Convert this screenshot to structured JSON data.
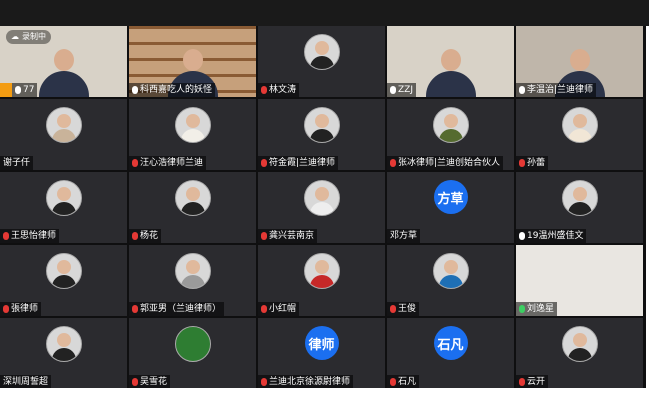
{
  "recording": {
    "label": "录制中"
  },
  "participant_count": "77",
  "tiles": [
    {
      "name": "",
      "type": "video"
    },
    {
      "name": "科西嘉吃人的妖怪",
      "type": "video"
    },
    {
      "name": "林文涛",
      "type": "avatar"
    },
    {
      "name": "ZZJ",
      "type": "video"
    },
    {
      "name": "李温治|兰迪律师",
      "type": "video"
    },
    {
      "name": "谢子仟",
      "type": "avatar"
    },
    {
      "name": "汪心浩律师兰迪",
      "type": "avatar"
    },
    {
      "name": "符金霞|兰迪律师",
      "type": "avatar"
    },
    {
      "name": "张冰律师|兰迪创始合伙人",
      "type": "avatar"
    },
    {
      "name": "孙蕾",
      "type": "avatar"
    },
    {
      "name": "王思怡律师",
      "type": "avatar"
    },
    {
      "name": "杨花",
      "type": "avatar"
    },
    {
      "name": "龚兴芸南京",
      "type": "avatar"
    },
    {
      "name": "邓方草",
      "type": "text",
      "avatar_text": "方草"
    },
    {
      "name": "19温州盛佳文",
      "type": "avatar"
    },
    {
      "name": "張律师",
      "type": "avatar"
    },
    {
      "name": "郭亚男（兰迪律师）",
      "type": "avatar"
    },
    {
      "name": "小红帽",
      "type": "avatar"
    },
    {
      "name": "王俊",
      "type": "avatar"
    },
    {
      "name": "刘逸星",
      "type": "video"
    },
    {
      "name": "深圳周誓超",
      "type": "avatar"
    },
    {
      "name": "吴雪花",
      "type": "avatar"
    },
    {
      "name": "兰迪北京徐源尉律师",
      "type": "text",
      "avatar_text": "律师"
    },
    {
      "name": "石凡",
      "type": "text",
      "avatar_text": "石凡"
    },
    {
      "name": "云开",
      "type": "avatar"
    }
  ]
}
